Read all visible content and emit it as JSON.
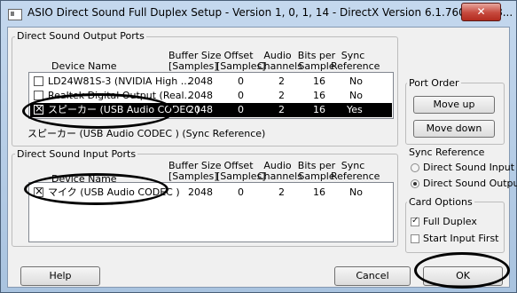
{
  "window": {
    "title": "ASIO Direct Sound Full Duplex Setup   -  Version 1, 0, 1, 14  -  DirectX Version 6.1.7600.1638...",
    "close_label": "✕"
  },
  "columns": {
    "buffer": [
      "Buffer Size",
      "[Samples]"
    ],
    "offset": [
      "Offset",
      "[Samples]"
    ],
    "audio": [
      "Audio",
      "Channels"
    ],
    "bits": [
      "Bits per",
      "Sample"
    ],
    "sync": [
      "Sync",
      "Reference"
    ]
  },
  "output": {
    "group_label": "Direct Sound Output Ports",
    "device_col": "Device Name",
    "rows": [
      {
        "checked": false,
        "name": "LD24W81S-3 (NVIDIA High ...",
        "buffer": "2048",
        "offset": "0",
        "channels": "2",
        "bits": "16",
        "sync": "No"
      },
      {
        "checked": false,
        "name": "Realtek Digital Output (Real...",
        "buffer": "2048",
        "offset": "0",
        "channels": "2",
        "bits": "16",
        "sync": "No"
      },
      {
        "checked": true,
        "name": "スピーカー (USB Audio CODEC )",
        "buffer": "2048",
        "offset": "0",
        "channels": "2",
        "bits": "16",
        "sync": "Yes"
      }
    ],
    "status": "スピーカー (USB Audio CODEC ) (Sync Reference)"
  },
  "input": {
    "group_label": "Direct Sound Input Ports",
    "device_col": "Device Name",
    "rows": [
      {
        "checked": true,
        "name": "マイク (USB Audio CODEC )",
        "buffer": "2048",
        "offset": "0",
        "channels": "2",
        "bits": "16",
        "sync": "No"
      }
    ]
  },
  "port_order": {
    "label": "Port Order",
    "move_up": "Move up",
    "move_down": "Move down"
  },
  "sync_reference": {
    "label": "Sync Reference",
    "input": "Direct Sound Input",
    "output": "Direct Sound Output",
    "selected": "output"
  },
  "card_options": {
    "label": "Card Options",
    "full_duplex": "Full Duplex",
    "full_duplex_checked": true,
    "start_input_first": "Start Input First",
    "start_input_first_checked": false
  },
  "buttons": {
    "help": "Help",
    "cancel": "Cancel",
    "ok": "OK"
  }
}
